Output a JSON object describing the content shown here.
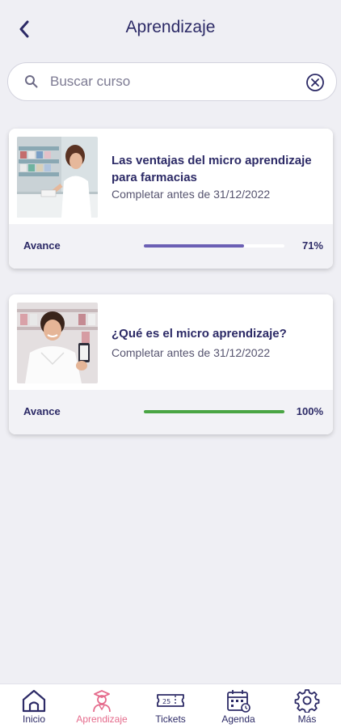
{
  "header": {
    "title": "Aprendizaje"
  },
  "search": {
    "placeholder": "Buscar curso",
    "value": ""
  },
  "courses": [
    {
      "title": "Las ventajas del micro aprendizaje para farmacias",
      "due": "Completar antes de 31/12/2022",
      "progress_label": "Avance",
      "progress_percent": 71,
      "progress_text": "71%",
      "bar_color": "#6b5fb4"
    },
    {
      "title": "¿Qué es el micro aprendizaje?",
      "due": "Completar antes de 31/12/2022",
      "progress_label": "Avance",
      "progress_percent": 100,
      "progress_text": "100%",
      "bar_color": "#4aa544"
    }
  ],
  "tabs": [
    {
      "label": "Inicio",
      "icon": "home-icon",
      "active": false
    },
    {
      "label": "Aprendizaje",
      "icon": "graduate-icon",
      "active": true
    },
    {
      "label": "Tickets",
      "icon": "ticket-icon",
      "active": false
    },
    {
      "label": "Agenda",
      "icon": "calendar-icon",
      "active": false
    },
    {
      "label": "Más",
      "icon": "gear-icon",
      "active": false
    }
  ],
  "colors": {
    "primary": "#2c2a66",
    "accent_active": "#e56b8c",
    "background": "#efeff4"
  }
}
